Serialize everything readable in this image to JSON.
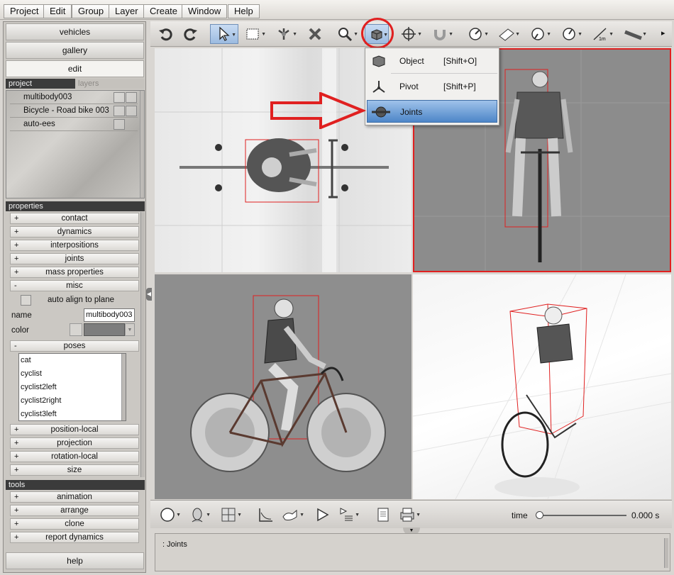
{
  "menubar": {
    "items": [
      "Project",
      "Edit",
      "Group",
      "Layer",
      "Create",
      "Window",
      "Help"
    ]
  },
  "left": {
    "buttons": {
      "vehicles": "vehicles",
      "gallery": "gallery",
      "edit": "edit",
      "help": "help"
    },
    "tabs": {
      "project": "project",
      "layers": "layers"
    },
    "tree": [
      "multibody003",
      "Bicycle - Road bike 003",
      "auto-ees"
    ],
    "properties_header": "properties",
    "properties": [
      {
        "sign": "+",
        "label": "contact"
      },
      {
        "sign": "+",
        "label": "dynamics"
      },
      {
        "sign": "+",
        "label": "interpositions"
      },
      {
        "sign": "+",
        "label": "joints"
      },
      {
        "sign": "+",
        "label": "mass properties"
      },
      {
        "sign": "-",
        "label": "misc"
      }
    ],
    "misc": {
      "auto_align_label": "auto align to plane",
      "name_label": "name",
      "name_value": "multibody003",
      "color_label": "color"
    },
    "poses": {
      "sign": "-",
      "label": "poses",
      "items": [
        "cat",
        "cyclist",
        "cyclist2left",
        "cyclist2right",
        "cyclist3left"
      ]
    },
    "properties_after": [
      {
        "sign": "+",
        "label": "position-local"
      },
      {
        "sign": "+",
        "label": "projection"
      },
      {
        "sign": "+",
        "label": "rotation-local"
      },
      {
        "sign": "+",
        "label": "size"
      }
    ],
    "tools_header": "tools",
    "tools": [
      {
        "sign": "+",
        "label": "animation"
      },
      {
        "sign": "+",
        "label": "arrange"
      },
      {
        "sign": "+",
        "label": "clone"
      },
      {
        "sign": "+",
        "label": "report dynamics"
      }
    ]
  },
  "toolbar": {
    "icons": [
      "undo-icon",
      "redo-icon",
      "select-arrow-icon",
      "rect-select-icon",
      "pivot-tool-icon",
      "delete-icon",
      "zoom-icon",
      "object-cube-icon",
      "move-icon",
      "magnet-icon",
      "gauge-icon",
      "ruler-icon",
      "protractor-icon",
      "speed-icon",
      "measure-icon",
      "tape-icon"
    ],
    "more": "▸"
  },
  "dropdown": {
    "items": [
      {
        "label": "Object",
        "shortcut": "[Shift+O]",
        "icon": "cube-icon"
      },
      {
        "label": "Pivot",
        "shortcut": "[Shift+P]",
        "icon": "pivot-icon"
      },
      {
        "label": "Joints",
        "shortcut": "",
        "icon": "joint-icon"
      }
    ],
    "highlighted": "Joints"
  },
  "bottombar": {
    "time_label": "time",
    "time_value": "0.000 s",
    "time_slider_fraction": 0
  },
  "status": {
    "text": ": Joints"
  },
  "colors": {
    "accent_red": "#e02020",
    "highlight_blue": "#4d86c8"
  }
}
